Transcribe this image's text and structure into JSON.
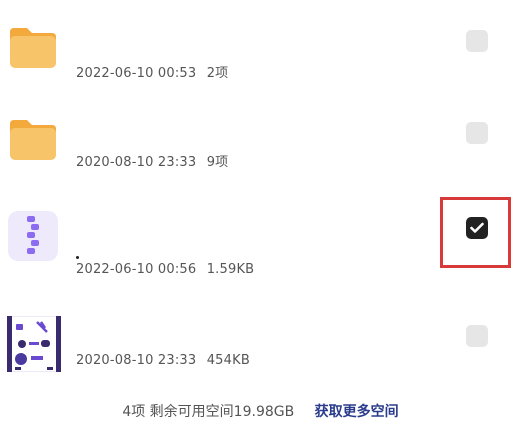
{
  "files": [
    {
      "date": "2022-06-10 00:53",
      "size": "2项",
      "icon": "folder-icon",
      "checked": false
    },
    {
      "date": "2020-08-10 23:33",
      "size": "9项",
      "icon": "folder-icon",
      "checked": false
    },
    {
      "date": "2022-06-10 00:56",
      "size": "1.59KB",
      "icon": "zip-file-icon",
      "checked": true
    },
    {
      "date": "2020-08-10 23:33",
      "size": "454KB",
      "icon": "image-thumbnail-icon",
      "checked": false
    }
  ],
  "footer": {
    "summary": "4项 剩余可用空间19.98GB",
    "link": "获取更多空间"
  },
  "colors": {
    "folder": "#f5b04a",
    "folder_tab": "#f7c46a",
    "zip_bg": "#eeeafc",
    "zip_accent": "#8c6cf0",
    "checkbox_checked": "#222222",
    "checkbox_unchecked": "#e6e6e6",
    "highlight": "#d83a3a",
    "link": "#2b3c8c"
  }
}
